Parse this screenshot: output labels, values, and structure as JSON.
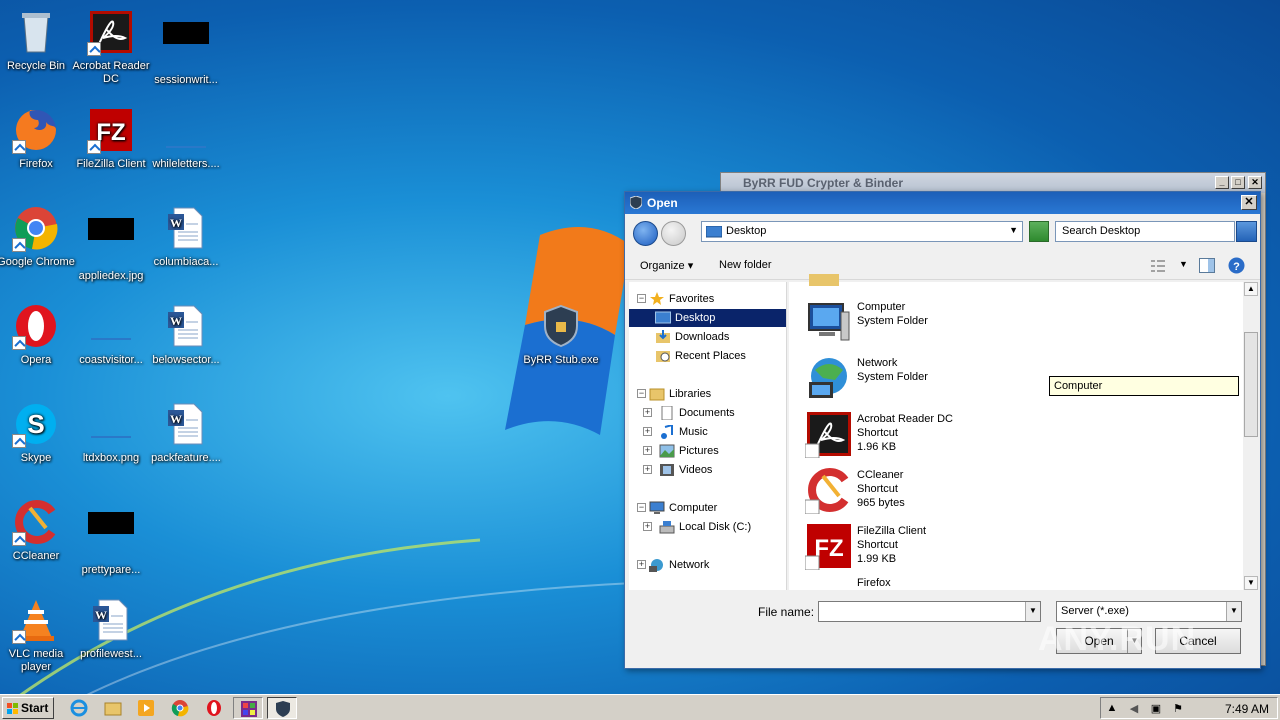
{
  "desktop": {
    "icons": [
      {
        "label": "Recycle Bin",
        "icon": "recycle-bin-icon"
      },
      {
        "label": "Acrobat Reader DC",
        "icon": "acrobat-icon"
      },
      {
        "label": "sessionwrit...",
        "icon": "redacted-thumbnail"
      },
      {
        "label": "Firefox",
        "icon": "firefox-icon"
      },
      {
        "label": "FileZilla Client",
        "icon": "filezilla-icon"
      },
      {
        "label": "whileletters....",
        "icon": "blank-file-icon"
      },
      {
        "label": "Google Chrome",
        "icon": "chrome-icon"
      },
      {
        "label": "appliedex.jpg",
        "icon": "redacted-thumbnail"
      },
      {
        "label": "columbiaca...",
        "icon": "word-doc-icon"
      },
      {
        "label": "Opera",
        "icon": "opera-icon"
      },
      {
        "label": "coastvisitor...",
        "icon": "blank-file-icon"
      },
      {
        "label": "belowsector...",
        "icon": "word-doc-icon"
      },
      {
        "label": "Skype",
        "icon": "skype-icon"
      },
      {
        "label": "ltdxbox.png",
        "icon": "blank-file-icon"
      },
      {
        "label": "packfeature....",
        "icon": "word-doc-icon"
      },
      {
        "label": "CCleaner",
        "icon": "ccleaner-icon"
      },
      {
        "label": "prettypare...",
        "icon": "redacted-thumbnail"
      },
      {
        "label": "VLC media player",
        "icon": "vlc-icon"
      },
      {
        "label": "profilewest...",
        "icon": "word-doc-icon"
      },
      {
        "label": "ByRR Stub.exe",
        "icon": "byrr-shield-icon"
      }
    ]
  },
  "bg_window": {
    "title": "ByRR FUD Crypter & Binder",
    "min": "_",
    "max": "□",
    "close": "✕"
  },
  "dialog": {
    "title": "Open",
    "close": "✕",
    "address": "Desktop",
    "search_placeholder": "Search Desktop",
    "toolbar": {
      "organize": "Organize ▾",
      "new_folder": "New folder"
    },
    "nav": {
      "favorites": "Favorites",
      "desktop": "Desktop",
      "downloads": "Downloads",
      "recent": "Recent Places",
      "libraries": "Libraries",
      "documents": "Documents",
      "music": "Music",
      "pictures": "Pictures",
      "videos": "Videos",
      "computer": "Computer",
      "local_disk": "Local Disk (C:)",
      "network": "Network"
    },
    "files": [
      {
        "name": "Computer",
        "type": "System Folder",
        "size": ""
      },
      {
        "name": "Network",
        "type": "System Folder",
        "size": ""
      },
      {
        "name": "Acrobat Reader DC",
        "type": "Shortcut",
        "size": "1.96 KB"
      },
      {
        "name": "CCleaner",
        "type": "Shortcut",
        "size": "965 bytes"
      },
      {
        "name": "FileZilla Client",
        "type": "Shortcut",
        "size": "1.99 KB"
      },
      {
        "name": "Firefox",
        "type": "",
        "size": ""
      }
    ],
    "tooltip": "Computer",
    "filename_label": "File name:",
    "filename_value": "",
    "filter": "Server  (*.exe)",
    "open_btn": "Open",
    "cancel_btn": "Cancel"
  },
  "watermark": "ANY.RUN",
  "taskbar": {
    "start": "Start",
    "clock": "7:49 AM"
  }
}
